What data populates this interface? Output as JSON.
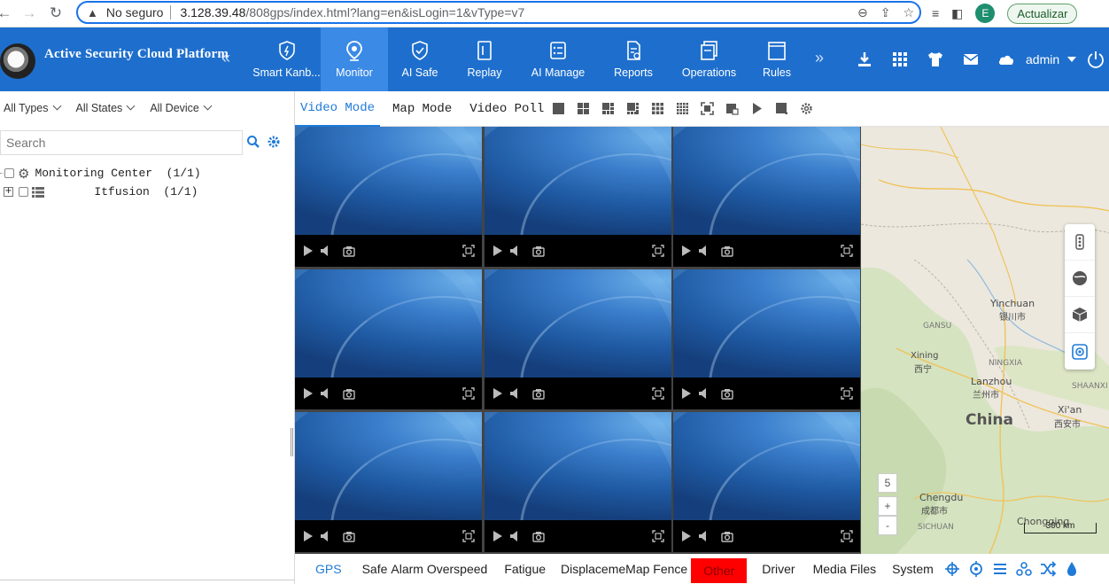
{
  "browser": {
    "not_secure": "No seguro",
    "url_host": "3.128.39.48",
    "url_path": "/808gps/index.html?lang=en&isLogin=1&vType=v7",
    "profile_initial": "E",
    "update_label": "Actualizar"
  },
  "header": {
    "app_title": "Active Security Cloud Platform",
    "nav": [
      {
        "label": "Smart Kanb...",
        "icon": "shield-icon"
      },
      {
        "label": "Monitor",
        "icon": "location-pin-icon",
        "active": true
      },
      {
        "label": "AI Safe",
        "icon": "shield-check-icon"
      },
      {
        "label": "Replay",
        "icon": "replay-icon"
      },
      {
        "label": "AI Manage",
        "icon": "checklist-icon"
      },
      {
        "label": "Reports",
        "icon": "report-icon"
      },
      {
        "label": "Operations",
        "icon": "operations-icon"
      },
      {
        "label": "Rules",
        "icon": "rules-icon"
      }
    ],
    "user": "admin",
    "colors": {
      "bar": "#1e6fcd",
      "active": "#3a8ae6"
    }
  },
  "sidebar": {
    "filters": [
      "All Types",
      "All States",
      "All Device"
    ],
    "search_placeholder": "Search",
    "tree": [
      {
        "label": "Monitoring Center  (1/1)",
        "icon": "gear-icon"
      },
      {
        "label": "Itfusion  (1/1)",
        "icon": "list-icon"
      }
    ]
  },
  "toolbar": {
    "modes": [
      "Video Mode",
      "Map Mode",
      "Video Poll"
    ],
    "active_mode": "Video Mode"
  },
  "video": {
    "rows": 3,
    "cols": 3
  },
  "map": {
    "labels": {
      "yinchuan": "Yinchuan",
      "yinchuan_cn": "银川市",
      "gansu": "GANSU",
      "ningxia": "NINGXIA",
      "xining": "Xining",
      "xining_cn": "西宁",
      "lanzhou": "Lanzhou",
      "lanzhou_cn": "兰州市",
      "shaanxi": "SHAANXI",
      "xian": "Xi'an",
      "xian_cn": "西安市",
      "china": "China",
      "chengdu": "Chengdu",
      "chengdu_cn": "成都市",
      "sichuan": "SICHUAN",
      "chongqing": "Chongqing"
    },
    "zoom_level": "5",
    "zoom_in": "+",
    "zoom_out": "-",
    "scale": "300 km"
  },
  "bottom_tabs": [
    "GPS",
    "Safe",
    "Alarm Overspeed",
    "Fatigue",
    "Displaceme",
    "Map Fence",
    "Other",
    "Driver",
    "Media Files",
    "System"
  ]
}
